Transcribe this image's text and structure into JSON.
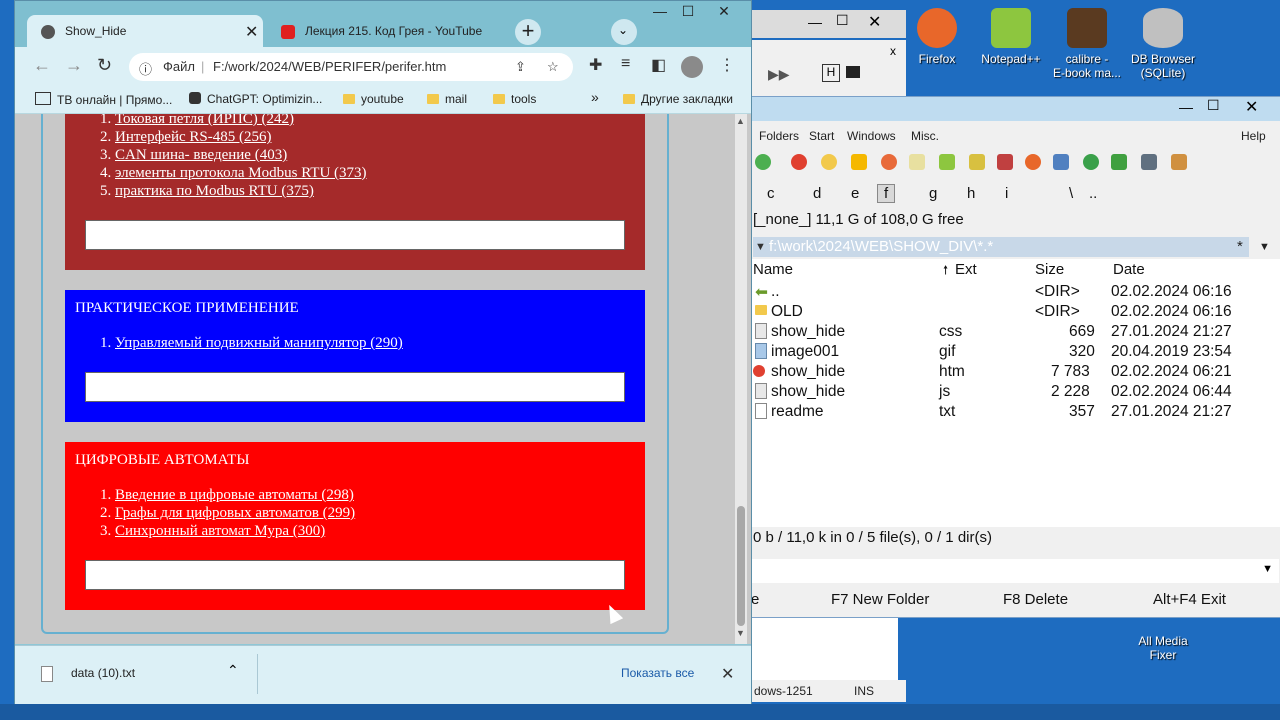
{
  "desktop": {
    "icons": [
      {
        "label": "Firefox",
        "icon": "firefox-icon",
        "color": "#e8672a"
      },
      {
        "label": "Notepad++",
        "icon": "notepad-icon",
        "color": "#8dc63f"
      },
      {
        "label": "calibre -\nE-book ma...",
        "icon": "calibre-icon",
        "color": "#5a3a20"
      },
      {
        "label": "DB Browser\n(SQLite)",
        "icon": "database-icon",
        "color": "#c0c0c0"
      },
      {
        "label": "All Media\nFixer",
        "icon": "media-icon",
        "color": "#2a5a8a"
      }
    ]
  },
  "tc": {
    "menu": [
      "Folders",
      "Start",
      "Windows",
      "Misc.",
      "Help"
    ],
    "drives": [
      "c",
      "d",
      "e",
      "f",
      "g",
      "h",
      "i",
      "\\",
      ".."
    ],
    "free_text": "[_none_]  11,1 G of 108,0 G free",
    "path": "f:\\work\\2024\\WEB\\SHOW_DIV\\*.*",
    "path_filter": "*",
    "columns": [
      "Name",
      "Ext",
      "Size",
      "Date"
    ],
    "files": [
      {
        "name": "..",
        "ext": "",
        "size": "<DIR>",
        "date": "02.02.2024 06:16"
      },
      {
        "name": "OLD",
        "ext": "",
        "size": "<DIR>",
        "date": "02.02.2024 06:16"
      },
      {
        "name": "show_hide",
        "ext": "css",
        "size": "669",
        "date": "27.01.2024 21:27"
      },
      {
        "name": "image001",
        "ext": "gif",
        "size": "320",
        "date": "20.04.2019 23:54"
      },
      {
        "name": "show_hide",
        "ext": "htm",
        "size": "7 783",
        "date": "02.02.2024 06:21"
      },
      {
        "name": "show_hide",
        "ext": "js",
        "size": "2 228",
        "date": "02.02.2024 06:44"
      },
      {
        "name": "readme",
        "ext": "txt",
        "size": "357",
        "date": "27.01.2024 21:27"
      }
    ],
    "status": "0 b / 11,0 k in 0 / 5 file(s), 0 / 1 dir(s)",
    "fkeys": [
      "e",
      "F7 New Folder",
      "F8 Delete",
      "Alt+F4 Exit"
    ]
  },
  "npp": {
    "status_encoding": "dows-1251",
    "status_ins": "INS"
  },
  "chrome": {
    "tabs": [
      {
        "title": "Show_Hide",
        "active": true
      },
      {
        "title": "Лекция 215. Код Грея - YouTube",
        "active": false
      }
    ],
    "omnibox": {
      "scheme": "Файл",
      "url": "F:/work/2024/WEB/PERIFER/perifer.htm"
    },
    "bookmarks": [
      "ТВ онлайн | Прямо...",
      "ChatGPT: Optimizin...",
      "youtube",
      "mail",
      "tools"
    ],
    "other_bookmarks": "Другие закладки",
    "overflow": "»",
    "download": {
      "file": "data (10).txt",
      "show_all": "Показать все"
    }
  },
  "page": {
    "sections": [
      {
        "heading": "",
        "color": "#a52a2a",
        "items": [
          "Токовая петля (ИРПС) (242)",
          "Интерфейс RS-485 (256)",
          "CAN шина- введение (403)",
          "элементы протокола Modbus RTU (373)",
          "практика по Modbus RTU (375)"
        ]
      },
      {
        "heading": "ПРАКТИЧЕСКОЕ ПРИМЕНЕНИЕ",
        "color": "#0000ff",
        "items": [
          "Управляемый подвижный манипулятор (290)"
        ]
      },
      {
        "heading": "ЦИФРОВЫЕ АВТОМАТЫ",
        "color": "#ff0000",
        "items": [
          "Введение в цифровые автоматы (298)",
          "Графы для цифровых автоматов (299)",
          "Синхронный автомат Мура (300)"
        ]
      }
    ]
  }
}
